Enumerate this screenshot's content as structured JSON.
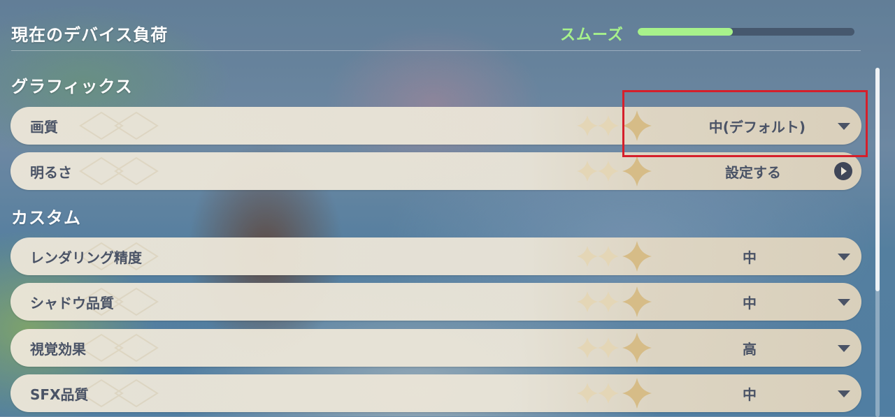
{
  "header": {
    "title": "現在のデバイス負荷",
    "load_status": "スムーズ",
    "load_level": 0.44
  },
  "sections": {
    "graphics": {
      "title": "グラフィックス",
      "rows": [
        {
          "label": "画質",
          "value": "中(デフォルト)",
          "control": "dropdown"
        },
        {
          "label": "明るさ",
          "value": "設定する",
          "control": "arrow"
        }
      ]
    },
    "custom": {
      "title": "カスタム",
      "rows": [
        {
          "label": "レンダリング精度",
          "value": "中",
          "control": "dropdown"
        },
        {
          "label": "シャドウ品質",
          "value": "中",
          "control": "dropdown"
        },
        {
          "label": "視覚効果",
          "value": "高",
          "control": "dropdown"
        },
        {
          "label": "SFX品質",
          "value": "中",
          "control": "dropdown"
        }
      ]
    }
  },
  "colors": {
    "status_green": "#a7f28b",
    "highlight_red": "#d51f2b",
    "row_text": "#4a5366"
  },
  "icons": {
    "dropdown": "chevron-down-icon",
    "arrow": "arrow-circle-right-icon"
  }
}
